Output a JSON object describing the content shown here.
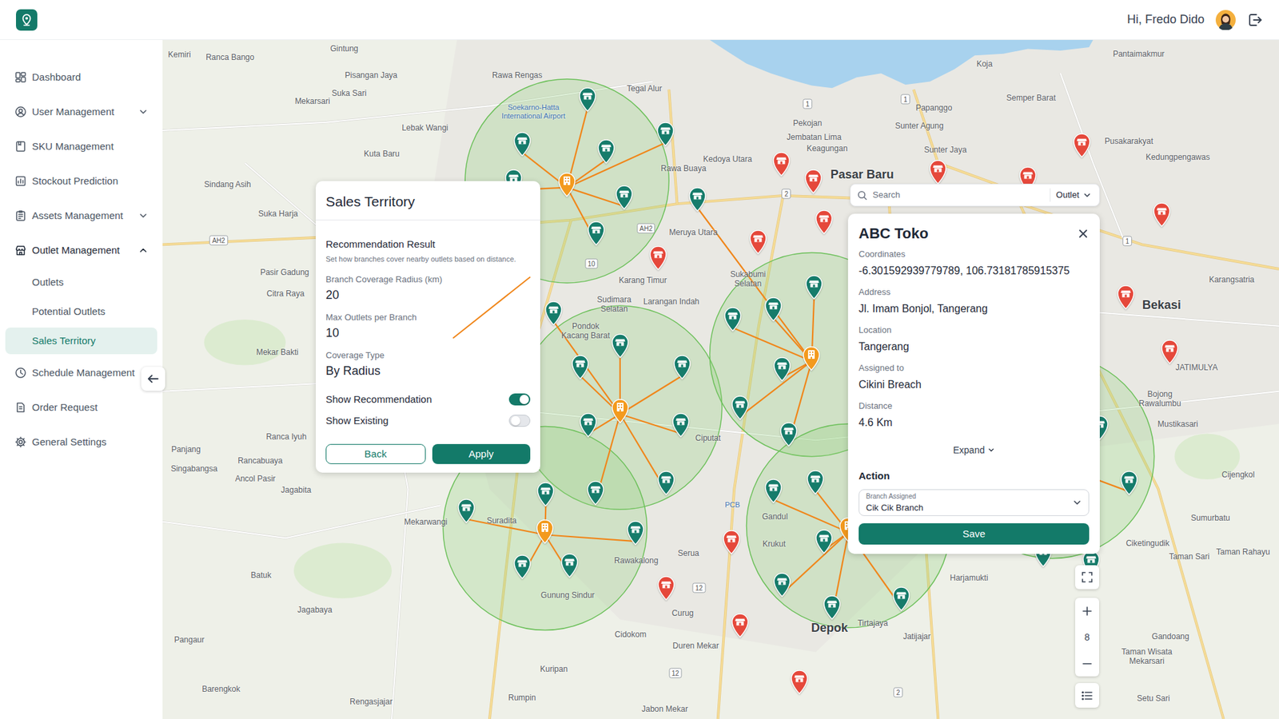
{
  "app": {
    "greeting": "Hi, Fredo Dido"
  },
  "sidebar": {
    "items": [
      {
        "label": "Dashboard",
        "kind": "link",
        "selected": false
      },
      {
        "label": "User Management",
        "kind": "group",
        "expanded": false,
        "selected": false
      },
      {
        "label": "SKU Management",
        "kind": "link",
        "selected": false
      },
      {
        "label": "Stockout Prediction",
        "kind": "link",
        "selected": false
      },
      {
        "label": "Assets Management",
        "kind": "group",
        "expanded": false,
        "selected": false
      },
      {
        "label": "Outlet Management",
        "kind": "group",
        "expanded": true,
        "selected": false
      },
      {
        "label": "Outlets",
        "kind": "subitem",
        "selected": false
      },
      {
        "label": "Potential Outlets",
        "kind": "subitem",
        "selected": false
      },
      {
        "label": "Sales Territory",
        "kind": "subitem",
        "selected": true
      },
      {
        "label": "Schedule Management",
        "kind": "link",
        "selected": false
      },
      {
        "label": "Order Request",
        "kind": "link",
        "selected": false
      },
      {
        "label": "General Settings",
        "kind": "link",
        "selected": false
      }
    ]
  },
  "territory_panel": {
    "title": "Sales Territory",
    "section_title": "Recommendation Result",
    "section_hint": "Set how branches cover nearby outlets based on distance.",
    "fields": [
      {
        "label": "Branch Coverage Radius (km)",
        "value": "20"
      },
      {
        "label": "Max Outlets per Branch",
        "value": "10"
      },
      {
        "label": "Coverage Type",
        "value": "By Radius"
      }
    ],
    "toggles": [
      {
        "label": "Show Recommendation",
        "on": true
      },
      {
        "label": "Show Existing",
        "on": false
      }
    ],
    "buttons": [
      "Back",
      "Apply"
    ]
  },
  "search": {
    "placeholder": "Search",
    "filter": "Outlet"
  },
  "outlet_detail": {
    "title": "ABC Toko",
    "fields": [
      {
        "label": "Coordinates",
        "value": "-6.301592939779789, 106.73181785915375"
      },
      {
        "label": "Address",
        "value": "Jl. Imam Bonjol, Tangerang"
      },
      {
        "label": "Location",
        "value": "Tangerang"
      },
      {
        "label": "Assigned to",
        "value": "Cikini Breach"
      },
      {
        "label": "Distance",
        "value": "4.6 Km"
      }
    ],
    "expand": "Expand",
    "action_title": "Action",
    "branch_select": {
      "label": "Branch Assigned",
      "value": "Cik Cik Branch"
    },
    "save": "Save"
  },
  "map": {
    "zoom": "8",
    "labels": [
      {
        "text": "Kemiri",
        "kind": "place"
      },
      {
        "text": "Ranca Bango",
        "kind": "place"
      },
      {
        "text": "Gintung",
        "kind": "place"
      },
      {
        "text": "Pisangan Jaya",
        "kind": "place"
      },
      {
        "text": "Rawa Rengas",
        "kind": "place"
      },
      {
        "text": "Tegal Alur",
        "kind": "place"
      },
      {
        "text": "Suka Sari",
        "kind": "place"
      },
      {
        "text": "Mekarsari",
        "kind": "place"
      },
      {
        "text": "Lebak Wangi",
        "kind": "place"
      },
      {
        "text": "Kuta Baru",
        "kind": "place"
      },
      {
        "text": "Sindang Asih",
        "kind": "place"
      },
      {
        "text": "Soekarno-Hatta International Airport",
        "kind": "poi"
      },
      {
        "text": "Rawa Buaya",
        "kind": "place"
      },
      {
        "text": "Kedoya Utara",
        "kind": "place"
      },
      {
        "text": "Pekojan",
        "kind": "place"
      },
      {
        "text": "Jembatan Lima",
        "kind": "place"
      },
      {
        "text": "Keagungan",
        "kind": "place"
      },
      {
        "text": "Papanggo",
        "kind": "place"
      },
      {
        "text": "Sunter Agung",
        "kind": "place"
      },
      {
        "text": "Semper Barat",
        "kind": "place"
      },
      {
        "text": "Koja",
        "kind": "place"
      },
      {
        "text": "Pantaimakmur",
        "kind": "place"
      },
      {
        "text": "Sunter Jaya",
        "kind": "place"
      },
      {
        "text": "Pusakarakyat",
        "kind": "place"
      },
      {
        "text": "Kedungpengawas",
        "kind": "place"
      },
      {
        "text": "Pasar Baru",
        "kind": "city"
      },
      {
        "text": "Suka Harja",
        "kind": "place"
      },
      {
        "text": "Meruya Utara",
        "kind": "place"
      },
      {
        "text": "Pasir Gadung",
        "kind": "place"
      },
      {
        "text": "Citra Raya",
        "kind": "place"
      },
      {
        "text": "Karang Timur",
        "kind": "place"
      },
      {
        "text": "Sukabumi Selatan",
        "kind": "place"
      },
      {
        "text": "Sudimara Selatan",
        "kind": "place"
      },
      {
        "text": "Larangan Indah",
        "kind": "place"
      },
      {
        "text": "Pondok Kacang Barat",
        "kind": "place"
      },
      {
        "text": "Mekar Bakti",
        "kind": "place"
      },
      {
        "text": "Ciputat",
        "kind": "place"
      },
      {
        "text": "Ranca Iyuh",
        "kind": "place"
      },
      {
        "text": "Panjang",
        "kind": "place"
      },
      {
        "text": "Rancabuaya",
        "kind": "place"
      },
      {
        "text": "Singabangsa",
        "kind": "place"
      },
      {
        "text": "Ancol Pasir",
        "kind": "place"
      },
      {
        "text": "Jagabita",
        "kind": "place"
      },
      {
        "text": "Mekarwangi",
        "kind": "place"
      },
      {
        "text": "Suradita",
        "kind": "place"
      },
      {
        "text": "PCB",
        "kind": "poi"
      },
      {
        "text": "Gandul",
        "kind": "place"
      },
      {
        "text": "Krukut",
        "kind": "place"
      },
      {
        "text": "Serua",
        "kind": "place"
      },
      {
        "text": "Rawakalong",
        "kind": "place"
      },
      {
        "text": "Batuk",
        "kind": "place"
      },
      {
        "text": "Harjamukti",
        "kind": "place"
      },
      {
        "text": "Gunung Sindur",
        "kind": "place"
      },
      {
        "text": "Jagabaya",
        "kind": "place"
      },
      {
        "text": "Curug",
        "kind": "place"
      },
      {
        "text": "Depok",
        "kind": "city"
      },
      {
        "text": "Tirtajaya",
        "kind": "place"
      },
      {
        "text": "Cidokom",
        "kind": "place"
      },
      {
        "text": "Jatijajar",
        "kind": "place"
      },
      {
        "text": "Pangaur",
        "kind": "place"
      },
      {
        "text": "Duren Mekar",
        "kind": "place"
      },
      {
        "text": "Kuripan",
        "kind": "place"
      },
      {
        "text": "Barengkok",
        "kind": "place"
      },
      {
        "text": "Rumpin",
        "kind": "place"
      },
      {
        "text": "Rengasjajar",
        "kind": "place"
      },
      {
        "text": "Jabon Mekar",
        "kind": "place"
      },
      {
        "text": "Bekasi",
        "kind": "city"
      },
      {
        "text": "Karangsatria",
        "kind": "place"
      },
      {
        "text": "JATIMULYA",
        "kind": "place"
      },
      {
        "text": "Bojong Rawalumbu",
        "kind": "place"
      },
      {
        "text": "Mustikasari",
        "kind": "place"
      },
      {
        "text": "Cijengkol",
        "kind": "place"
      },
      {
        "text": "Sumurbatu",
        "kind": "place"
      },
      {
        "text": "Ciketingudik",
        "kind": "place"
      },
      {
        "text": "Taman Sari",
        "kind": "place"
      },
      {
        "text": "Taman Rahayu",
        "kind": "place"
      },
      {
        "text": "Gandoang",
        "kind": "place"
      },
      {
        "text": "Taman Wisata Mekarsari",
        "kind": "place"
      },
      {
        "text": "Setu Sari",
        "kind": "place"
      }
    ],
    "road_shields": [
      "AH2",
      "AH2",
      "1",
      "1",
      "1",
      "2",
      "12",
      "12",
      "2",
      "10"
    ],
    "pins": [
      {
        "kind": "branch"
      },
      {
        "kind": "branch"
      },
      {
        "kind": "branch"
      },
      {
        "kind": "branch"
      },
      {
        "kind": "branch"
      },
      {
        "kind": "branch"
      },
      {
        "kind": "outlet"
      },
      {
        "kind": "outlet"
      },
      {
        "kind": "outlet"
      },
      {
        "kind": "outlet"
      },
      {
        "kind": "outlet"
      },
      {
        "kind": "outlet"
      },
      {
        "kind": "outlet"
      },
      {
        "kind": "outlet"
      },
      {
        "kind": "outlet"
      },
      {
        "kind": "outlet"
      },
      {
        "kind": "outlet"
      },
      {
        "kind": "outlet"
      },
      {
        "kind": "outlet"
      },
      {
        "kind": "outlet"
      },
      {
        "kind": "outlet"
      },
      {
        "kind": "outlet"
      },
      {
        "kind": "outlet"
      },
      {
        "kind": "outlet"
      },
      {
        "kind": "outlet"
      },
      {
        "kind": "outlet"
      },
      {
        "kind": "outlet"
      },
      {
        "kind": "outlet"
      },
      {
        "kind": "outlet"
      },
      {
        "kind": "outlet"
      },
      {
        "kind": "outlet"
      },
      {
        "kind": "outlet"
      },
      {
        "kind": "outlet"
      },
      {
        "kind": "outlet"
      },
      {
        "kind": "outlet"
      },
      {
        "kind": "outlet"
      },
      {
        "kind": "outlet"
      },
      {
        "kind": "outlet"
      },
      {
        "kind": "outlet"
      },
      {
        "kind": "outlet"
      },
      {
        "kind": "outlet"
      },
      {
        "kind": "outlet"
      },
      {
        "kind": "outlet"
      },
      {
        "kind": "potential"
      },
      {
        "kind": "potential"
      },
      {
        "kind": "potential"
      },
      {
        "kind": "potential"
      },
      {
        "kind": "potential"
      },
      {
        "kind": "potential"
      },
      {
        "kind": "potential"
      },
      {
        "kind": "potential"
      },
      {
        "kind": "potential"
      },
      {
        "kind": "potential"
      },
      {
        "kind": "potential"
      },
      {
        "kind": "potential"
      },
      {
        "kind": "potential"
      },
      {
        "kind": "potential"
      },
      {
        "kind": "potential"
      }
    ]
  }
}
